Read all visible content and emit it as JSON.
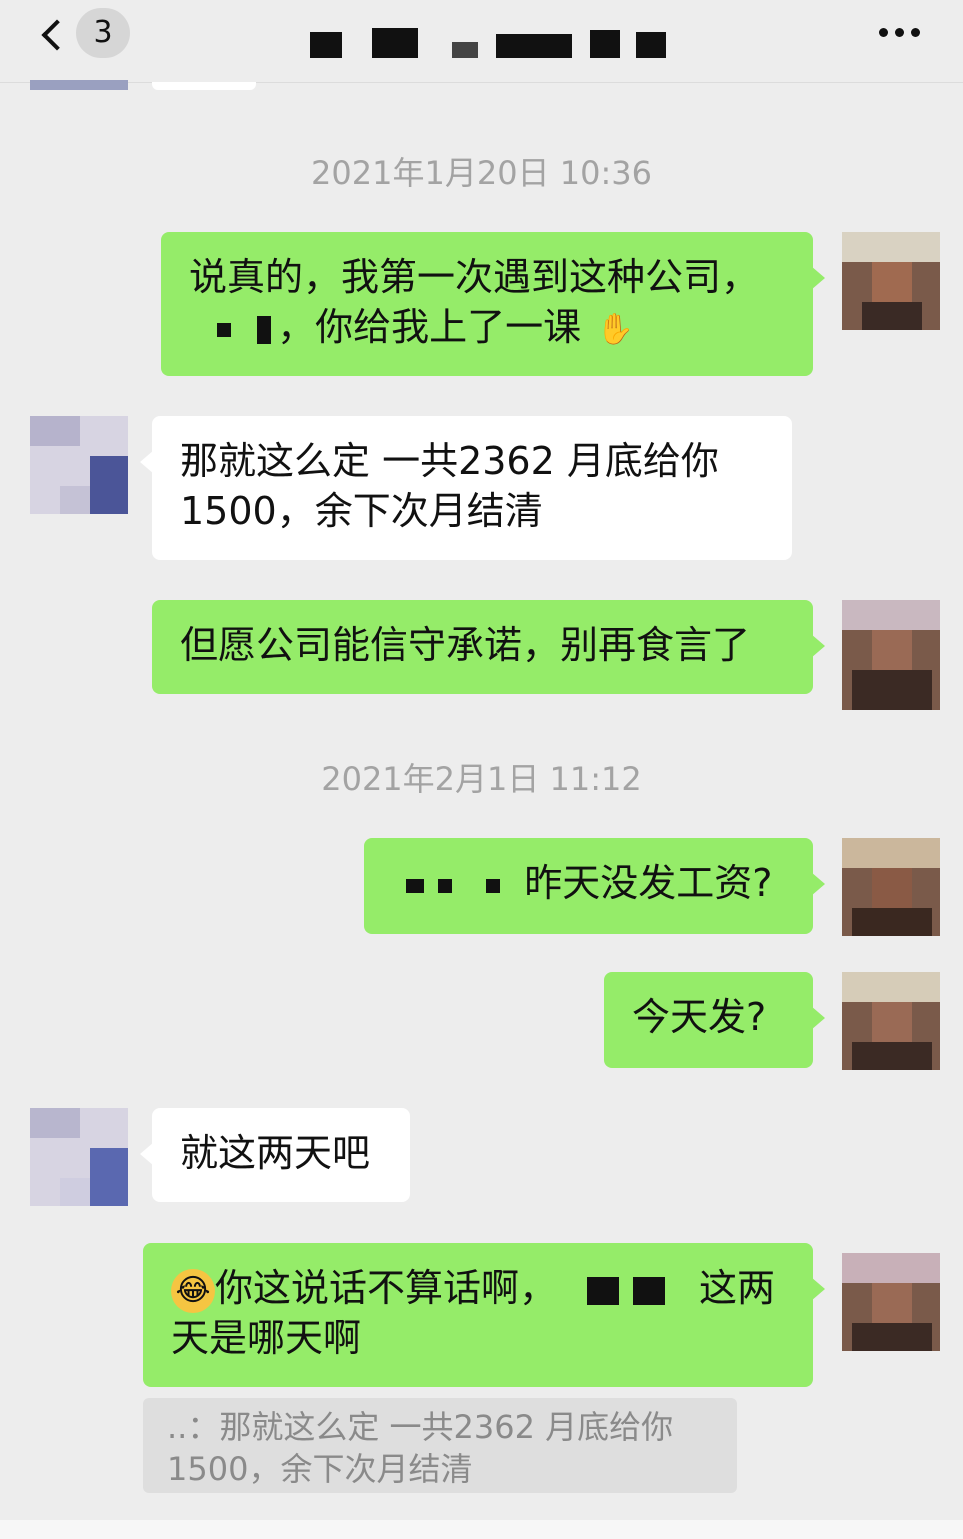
{
  "header": {
    "unread_count": "3",
    "title": ""
  },
  "messages": [
    {
      "type": "time",
      "text": "2021年1月20日 10:36"
    },
    {
      "type": "self",
      "line1": "说真的，我第一次遇到这种公司，",
      "line2": "，你给我上了一课"
    },
    {
      "type": "other",
      "line1": "那就这么定  一共2362  月底给你",
      "line2": "1500，余下次月结清"
    },
    {
      "type": "self",
      "line1": "但愿公司能信守承诺，别再食言了"
    },
    {
      "type": "time",
      "text": "2021年2月1日 11:12"
    },
    {
      "type": "self",
      "line1": "昨天没发工资?"
    },
    {
      "type": "self",
      "line1": "今天发?"
    },
    {
      "type": "other",
      "line1": "就这两天吧"
    },
    {
      "type": "self",
      "line1": "你这说话不算话啊，",
      "line1b": "这两",
      "line2": "天是哪天啊"
    }
  ],
  "quote": {
    "line1": "..：那就这么定  一共2362  月底给你",
    "line2": "1500，余下次月结清"
  },
  "colors": {
    "self_bubble": "#95ec69",
    "other_bubble": "#ffffff",
    "background": "#ededed"
  },
  "icons": {
    "back": "chevron-left-icon",
    "more": "more-dots-icon"
  }
}
